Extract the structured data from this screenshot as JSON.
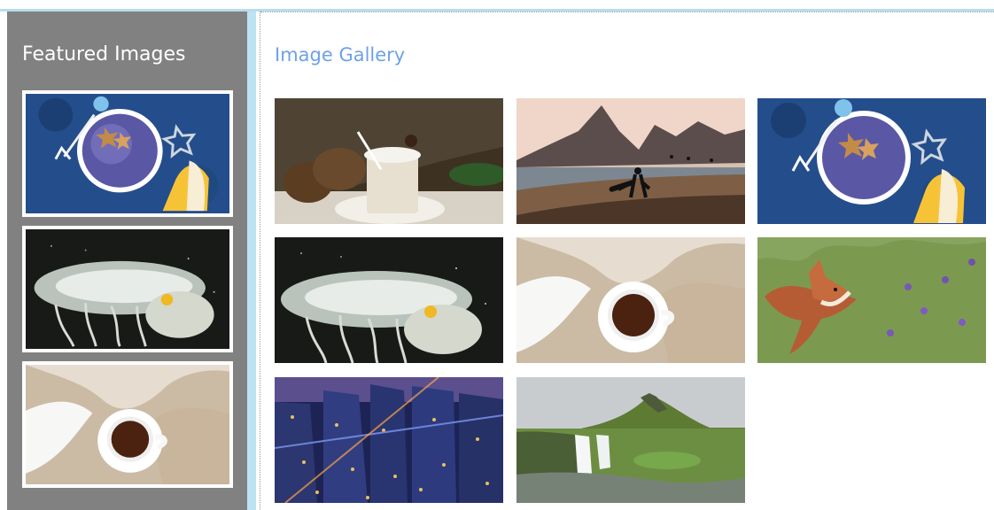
{
  "sidebar": {
    "title": "Featured Images",
    "items": [
      {
        "icon": "berry-bowl-image"
      },
      {
        "icon": "jellyfish-image"
      },
      {
        "icon": "tea-cup-image"
      }
    ]
  },
  "gallery": {
    "title": "Image Gallery",
    "items": [
      {
        "icon": "milkshake-image"
      },
      {
        "icon": "beach-surfer-image"
      },
      {
        "icon": "berry-bowl-image"
      },
      {
        "icon": "jellyfish-image"
      },
      {
        "icon": "tea-cup-image"
      },
      {
        "icon": "fox-image"
      },
      {
        "icon": "city-night-image"
      },
      {
        "icon": "waterfall-mountain-image"
      }
    ]
  },
  "colors": {
    "sidebar_bg": "#818181",
    "title_blue": "#6ea1e8",
    "divider_blue": "#bde3f3"
  }
}
